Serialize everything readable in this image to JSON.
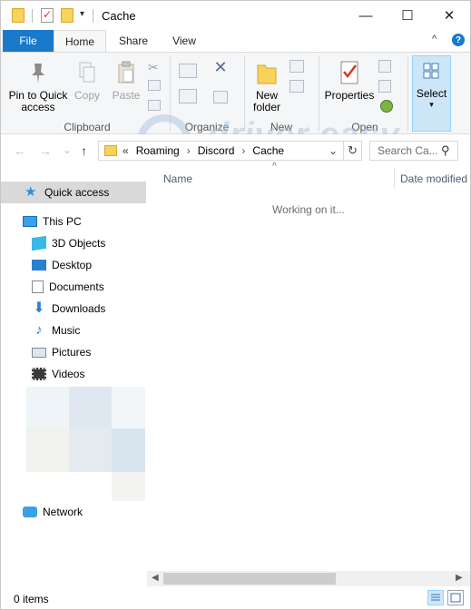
{
  "window": {
    "title": "Cache",
    "controls": {
      "minimize": "—",
      "maximize": "☐",
      "close": "✕"
    }
  },
  "quick_access_toolbar": {
    "dropdown_glyph": "▾"
  },
  "ribbon_tabs": {
    "file": "File",
    "home": "Home",
    "share": "Share",
    "view": "View",
    "collapse_glyph": "^",
    "help_glyph": "?"
  },
  "ribbon": {
    "clipboard": {
      "pin_label": "Pin to Quick access",
      "pin_line1": "Pin to Quick",
      "pin_line2": "access",
      "copy_label": "Copy",
      "paste_label": "Paste",
      "group_label": "Clipboard"
    },
    "organize": {
      "group_label": "Organize",
      "delete_glyph": "✕"
    },
    "new": {
      "new_folder_line1": "New",
      "new_folder_line2": "folder",
      "group_label": "New"
    },
    "open": {
      "properties_label": "Properties",
      "group_label": "Open"
    },
    "select": {
      "select_label": "Select"
    },
    "watermark": {
      "brand": "driver easy",
      "url": "www.DriverEasy.com"
    }
  },
  "navigation": {
    "back_glyph": "←",
    "forward_glyph": "→",
    "recent_glyph": "⌄",
    "up_glyph": "↑",
    "breadcrumb_overflow": "«",
    "breadcrumb": [
      "Roaming",
      "Discord",
      "Cache"
    ],
    "separator": "›",
    "dropdown_glyph": "⌄",
    "refresh_glyph": "↻",
    "search_placeholder": "Search Ca...",
    "search_icon_glyph": "⚲"
  },
  "nav_pane": {
    "quick_access": "Quick access",
    "this_pc": "This PC",
    "items": [
      {
        "label": "3D Objects",
        "icon": "3d-objects-icon"
      },
      {
        "label": "Desktop",
        "icon": "desktop-icon"
      },
      {
        "label": "Documents",
        "icon": "documents-icon"
      },
      {
        "label": "Downloads",
        "icon": "downloads-icon"
      },
      {
        "label": "Music",
        "icon": "music-icon"
      },
      {
        "label": "Pictures",
        "icon": "pictures-icon"
      },
      {
        "label": "Videos",
        "icon": "videos-icon"
      }
    ],
    "network": "Network"
  },
  "content": {
    "columns": {
      "name": "Name",
      "date_modified": "Date modified"
    },
    "sort_caret": "^",
    "status_message": "Working on it..."
  },
  "statusbar": {
    "item_count": "0 items"
  },
  "colors": {
    "accent": "#1979ca",
    "ribbon_bg": "#f5f6f7",
    "selected_nav": "#d9d9d9",
    "select_highlight": "#cde6f7",
    "folder": "#f7d35b"
  }
}
